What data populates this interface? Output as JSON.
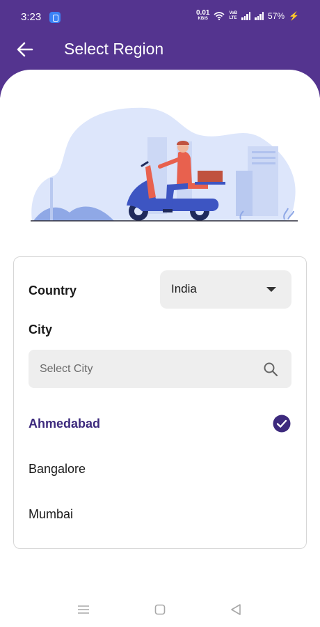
{
  "status_bar": {
    "time": "3:23",
    "net_speed_value": "0.01",
    "net_speed_unit": "KB/S",
    "volte_top": "VoB",
    "volte_bottom": "LTE",
    "battery": "57%",
    "icons": [
      "app-notification-icon",
      "wifi-icon",
      "signal-icon",
      "signal-icon",
      "charging-icon"
    ]
  },
  "app_bar": {
    "title": "Select Region",
    "back_icon": "arrow-left-icon"
  },
  "illustration": {
    "description_icon": "delivery-scooter-illustration"
  },
  "form": {
    "country_label": "Country",
    "country_value": "India",
    "city_label": "City",
    "city_search_placeholder": "Select City",
    "search_icon": "search-icon"
  },
  "cities": [
    {
      "name": "Ahmedabad",
      "selected": true
    },
    {
      "name": "Bangalore",
      "selected": false
    },
    {
      "name": "Mumbai",
      "selected": false
    }
  ],
  "colors": {
    "primary": "#54348f",
    "selected_text": "#3d2a7d",
    "field_bg": "#eeeeee",
    "illustration_bg": "#dde6fb",
    "accent_red": "#e8614e"
  },
  "nav_bar": {
    "icons": [
      "menu-icon",
      "home-square-icon",
      "back-triangle-icon"
    ]
  }
}
